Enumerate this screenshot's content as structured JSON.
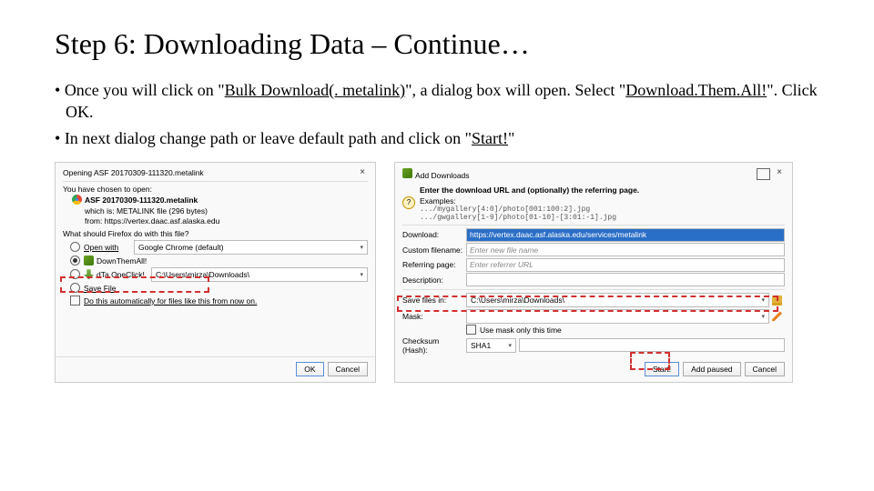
{
  "title": "Step 6: Downloading Data – Continue…",
  "bullets": [
    {
      "pre": "Once you will click on \"",
      "u": "Bulk Download(. metalink)",
      "post": "\", a dialog box will open. Select \"",
      "u2": "Download.Them.All!",
      "post2": "\". Click OK."
    },
    {
      "pre": "In next dialog change path or leave default path and click on \"",
      "u": "Start!",
      "post": "\""
    }
  ],
  "p1": {
    "title": "Opening ASF 20170309-111320.metalink",
    "choose": "You have chosen to open:",
    "file": "ASF 20170309-111320.metalink",
    "type": "which is: METALINK file (296 bytes)",
    "from": "from: https://vertex.daac.asf.alaska.edu",
    "what": "What should Firefox do with this file?",
    "open": "Open with",
    "open_val": "Google Chrome (default)",
    "down": "DownThemAll!",
    "one": "dTa OneClick!",
    "one_val": "C:\\Users\\mirza\\Downloads\\",
    "save": "Save File",
    "auto": "Do this automatically for files like this from now on.",
    "ok": "OK",
    "cancel": "Cancel"
  },
  "p2": {
    "title": "Add Downloads",
    "header": "Enter the download URL and (optionally) the referring page.",
    "examples_lbl": "Examples:",
    "ex1": ".../mygallery[4:0]/photo[001:100:2].jpg",
    "ex2": ".../gwgallery[1-9]/photo[01-10]-[3:01:-1].jpg",
    "download_lbl": "Download:",
    "download_val": "https://vertex.daac.asf.alaska.edu/services/metalink",
    "custom_lbl": "Custom filename:",
    "custom_ph": "Enter new file name",
    "ref_lbl": "Referring page:",
    "ref_ph": "Enter referrer URL",
    "desc_lbl": "Description:",
    "save_lbl": "Save files in:",
    "save_val": "C:\\Users\\mirza\\Downloads\\",
    "mask_lbl": "Mask:",
    "mask_cb": "Use mask only this time",
    "chk_lbl": "Checksum (Hash):",
    "chk_val": "SHA1",
    "start": "Start!",
    "paused": "Add paused",
    "cancel": "Cancel"
  }
}
